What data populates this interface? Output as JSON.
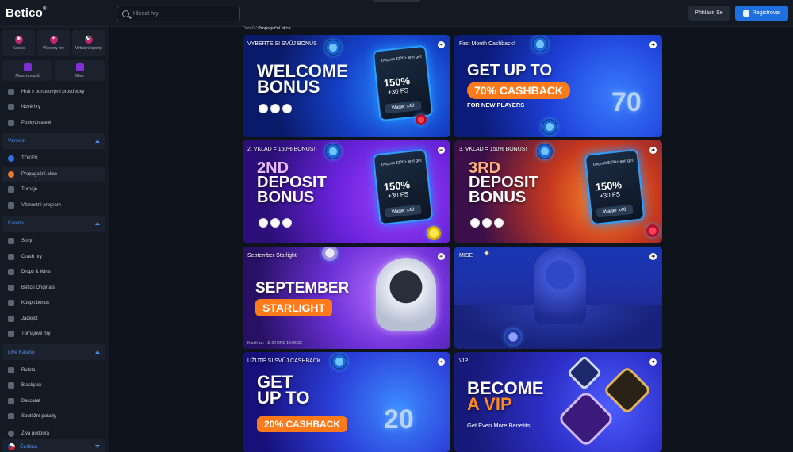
{
  "header": {
    "logo": "Betico",
    "logo_mark": "®",
    "search_placeholder": "Hledat hry",
    "login_label": "Přihlásit Se",
    "register_label": "Registrovat"
  },
  "sidebar": {
    "tiles": [
      {
        "label": "Kasino",
        "icon": "casino-chip-icon"
      },
      {
        "label": "Všechny hry",
        "icon": "games-icon"
      },
      {
        "label": "Virtuální sporty",
        "icon": "virtual-sports-icon"
      }
    ],
    "tiles2": [
      {
        "label": "Mapa bonusů",
        "icon": "bonus-map-icon"
      },
      {
        "label": "Mise",
        "icon": "missions-icon"
      }
    ],
    "top_items": [
      "Hrát s bonusovými prostředky",
      "Nové hry",
      "Poskytovatelé"
    ],
    "sections": [
      {
        "title": "Věrnost",
        "items": [
          "TOKEN",
          "Propagační akce",
          "Turnaje",
          "Věrnostní program"
        ]
      },
      {
        "title": "Kasino",
        "items": [
          "Sloty",
          "Crash hry",
          "Drops & Wins",
          "Betico Originals",
          "Koupit bonus",
          "Jackpot",
          "Turnajové hry"
        ]
      },
      {
        "title": "Live Kasino",
        "items": [
          "Ruleta",
          "Blackjack",
          "Baccarat",
          "Soutěžní pořady"
        ]
      }
    ],
    "support": "Živá podpora",
    "language": "Čeština",
    "active_item": "Propagační akce"
  },
  "breadcrumb": {
    "home": "Domů",
    "sep": "/",
    "current": "Propagační akce"
  },
  "promos": [
    {
      "title": "VYBERTE SI SVŮJ BONUS",
      "headline": [
        "WELCOME",
        "BONUS"
      ],
      "phone": {
        "top": "Deposit $200+ and get:",
        "pct": "150%",
        "fs": "+30 FS",
        "wager": "Wager x40"
      }
    },
    {
      "title": "First Month Cashback!",
      "headline": [
        "GET UP TO"
      ],
      "pill": "70% CASHBACK",
      "sub": "FOR NEW PLAYERS",
      "badge_number": "70"
    },
    {
      "title": "2. VKLAD = 150% BONUS!",
      "headline": [
        "2ND",
        "DEPOSIT",
        "BONUS"
      ],
      "phone": {
        "top": "Deposit $200+ and get:",
        "pct": "150%",
        "fs": "+30 FS",
        "wager": "Wager x40"
      }
    },
    {
      "title": "3. VKLAD = 150% BONUS!",
      "headline": [
        "3RD",
        "DEPOSIT",
        "BONUS"
      ],
      "phone": {
        "top": "Deposit $200+ and get:",
        "pct": "150%",
        "fs": "+30 FS",
        "wager": "Wager x40"
      }
    },
    {
      "title": "September Starlight",
      "headline": [
        "SEPTEMBER"
      ],
      "pill": "STARLIGHT",
      "ends_label": "Končí za:",
      "ends_value": "20 DNE 14:06:22"
    },
    {
      "title": "MISE"
    },
    {
      "title": "UŽIJTE SI SVŮJ CASHBACK",
      "headline": [
        "GET",
        "UP TO"
      ],
      "pill": "20% CASHBACK",
      "badge_number": "20"
    },
    {
      "title": "VIP",
      "headline": [
        "BECOME",
        "A VIP"
      ],
      "sub": "Get Even More Benefits"
    }
  ],
  "colors": {
    "accent": "#1e6fe0",
    "orange": "#ff7a1a",
    "bg": "#0f141c"
  }
}
